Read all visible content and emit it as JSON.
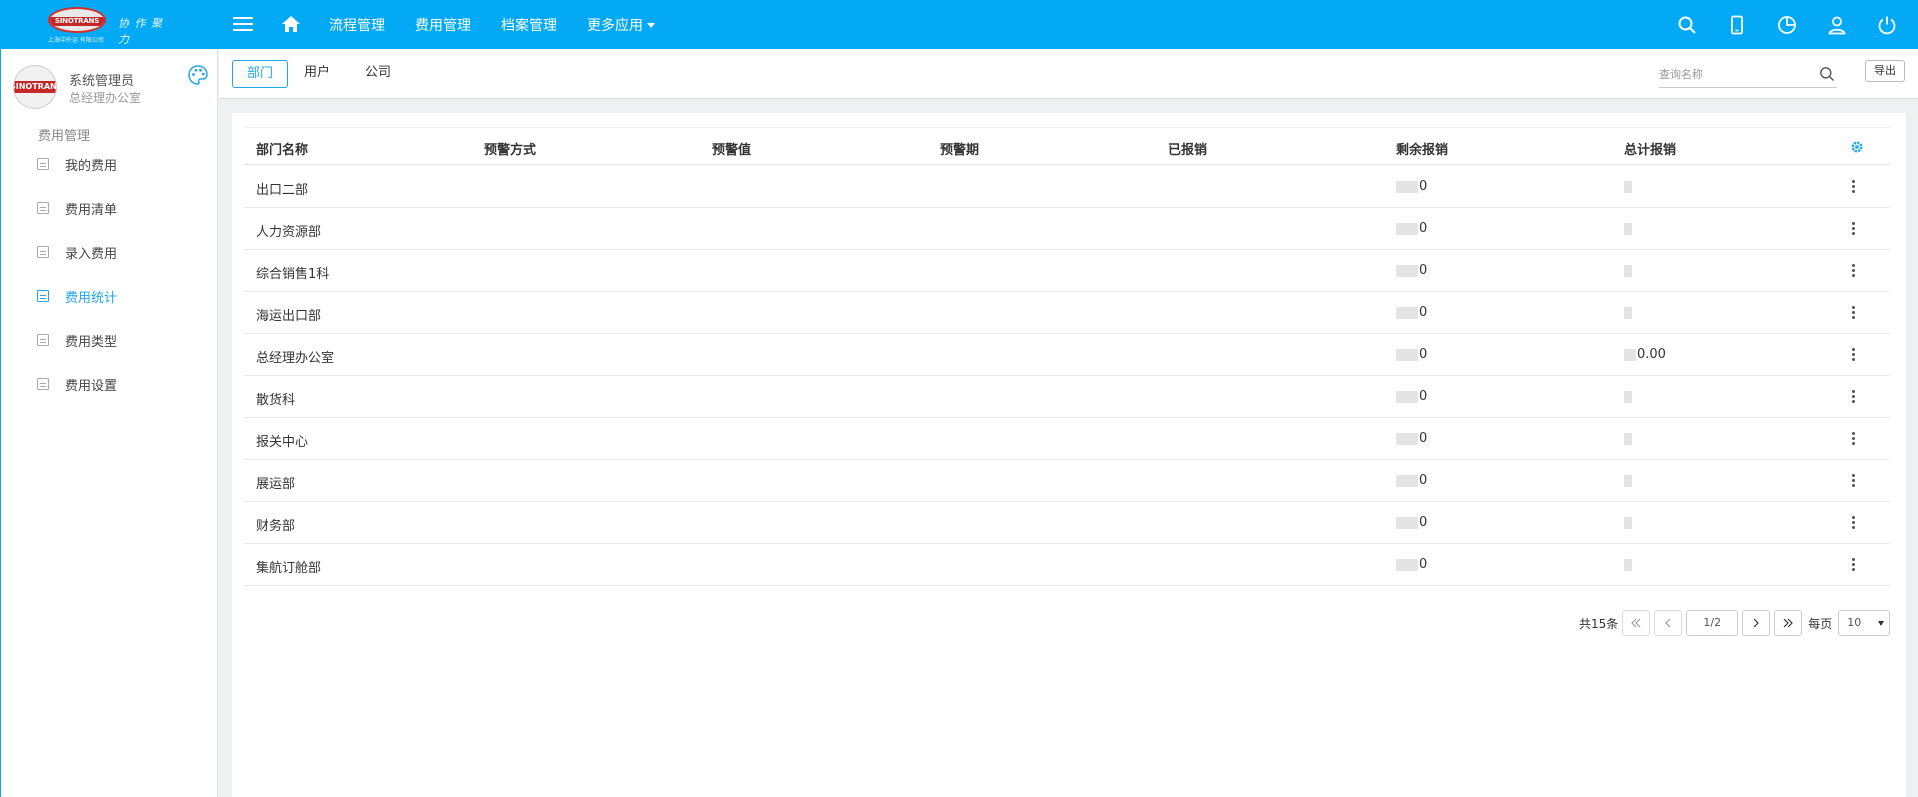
{
  "colors": {
    "primary": "#03a9f4",
    "accent": "#1ea7e9"
  },
  "logo": {
    "badge": "SINOTRANS",
    "slogan": "协 作 聚 力",
    "company": "上海中外运 有限公司"
  },
  "nav": {
    "items": [
      "流程管理",
      "费用管理",
      "档案管理",
      "更多应用"
    ],
    "icons": [
      "search-icon",
      "mobile-icon",
      "pie-chart-icon",
      "user-icon",
      "power-icon"
    ]
  },
  "user": {
    "name": "系统管理员",
    "dept": "总经理办公室",
    "avatar_text": "SINOTRANS"
  },
  "sidebar": {
    "section": "费用管理",
    "items": [
      {
        "label": "我的费用",
        "active": false
      },
      {
        "label": "费用清单",
        "active": false
      },
      {
        "label": "录入费用",
        "active": false
      },
      {
        "label": "费用统计",
        "active": true
      },
      {
        "label": "费用类型",
        "active": false
      },
      {
        "label": "费用设置",
        "active": false
      }
    ]
  },
  "tabs": [
    {
      "label": "部门",
      "active": true
    },
    {
      "label": "用户",
      "active": false
    },
    {
      "label": "公司",
      "active": false
    }
  ],
  "search": {
    "placeholder": "查询名称",
    "value": ""
  },
  "export_label": "导出",
  "table": {
    "columns": [
      "部门名称",
      "预警方式",
      "预警值",
      "预警期",
      "已报销",
      "剩余报销",
      "总计报销"
    ],
    "rows": [
      {
        "name": "出口二部",
        "remaining": "0",
        "total": ""
      },
      {
        "name": "人力资源部",
        "remaining": "0",
        "total": ""
      },
      {
        "name": "综合销售1科",
        "remaining": "0",
        "total": ""
      },
      {
        "name": "海运出口部",
        "remaining": "0",
        "total": ""
      },
      {
        "name": "总经理办公室",
        "remaining": "0",
        "total": "0.00"
      },
      {
        "name": "散货科",
        "remaining": "0",
        "total": ""
      },
      {
        "name": "报关中心",
        "remaining": "0",
        "total": ""
      },
      {
        "name": "展运部",
        "remaining": "0",
        "total": ""
      },
      {
        "name": "财务部",
        "remaining": "0",
        "total": ""
      },
      {
        "name": "集航订舱部",
        "remaining": "0",
        "total": ""
      }
    ]
  },
  "pager": {
    "total": "共15条",
    "page": "1/2",
    "per_page_label": "每页",
    "per_page": "10"
  }
}
